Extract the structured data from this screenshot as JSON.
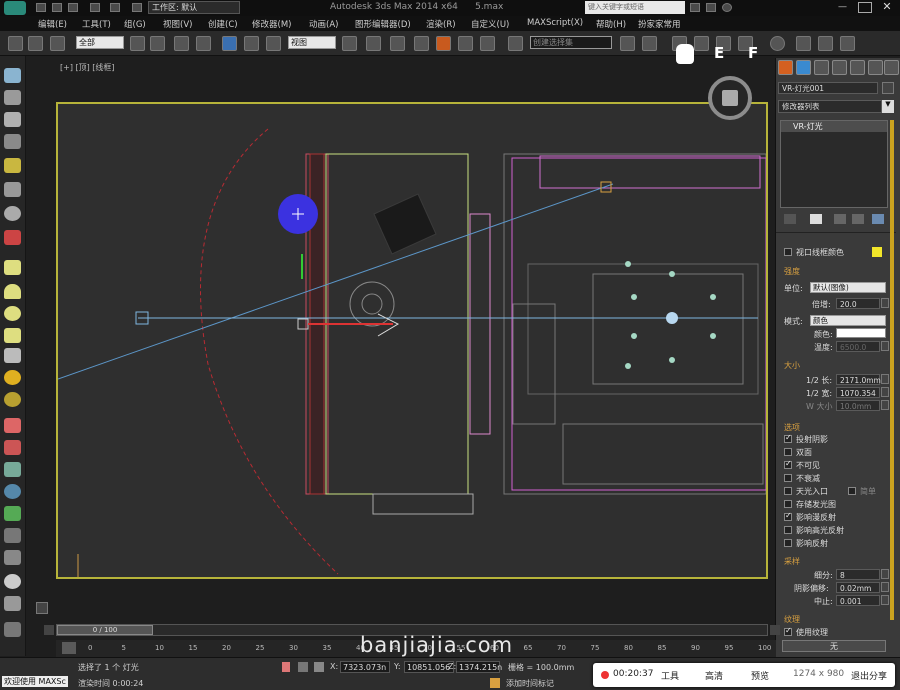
{
  "titlebar": {
    "workspace_label": "工作区: 默认",
    "app_title": "Autodesk 3ds Max  2014 x64",
    "file_name": "5.max",
    "search_placeholder": "键入关键字或短语"
  },
  "menus": [
    "编辑(E)",
    "工具(T)",
    "组(G)",
    "视图(V)",
    "创建(C)",
    "修改器(M)",
    "动画(A)",
    "图形编辑器(D)",
    "渲染(R)",
    "自定义(U)",
    "MAXScript(X)",
    "帮助(H)",
    "扮家家常用"
  ],
  "toolbar": {
    "selection_filter": "全部",
    "reference_coord": "视图",
    "selection_set": "创建选择集"
  },
  "viewport": {
    "label": "[+] [顶] [线框]",
    "hud_letters": [
      "E",
      "F"
    ]
  },
  "panel": {
    "object_name": "VR-灯光001",
    "modifier_list": "修改器列表",
    "stack_item": "VR-灯光",
    "viewport_wire_color": "视口线框颜色",
    "intensity_title": "强度",
    "unit_label": "单位:",
    "unit_value": "默认(图像)",
    "multiplier_label": "倍增:",
    "multiplier_value": "20.0",
    "mode_label": "模式:",
    "mode_value": "颜色",
    "color_label": "颜色:",
    "temp_label": "温度:",
    "temp_value": "6500.0",
    "size_title": "大小",
    "half_length_label": "1/2 长:",
    "half_length_value": "2171.0mm",
    "half_width_label": "1/2 宽:",
    "half_width_value": "1070.354",
    "w_size_label": "W 大小",
    "w_size_value": "10.0mm",
    "options_title": "选项",
    "options": [
      {
        "label": "投射阴影",
        "checked": true
      },
      {
        "label": "双面",
        "checked": false
      },
      {
        "label": "不可见",
        "checked": true
      },
      {
        "label": "不衰减",
        "checked": false
      },
      {
        "label": "天光入口",
        "checked": false
      },
      {
        "label": "存储发光图",
        "checked": false
      },
      {
        "label": "影响漫反射",
        "checked": true
      },
      {
        "label": "影响高光反射",
        "checked": false
      },
      {
        "label": "影响反射",
        "checked": false
      }
    ],
    "simple_label": "简单",
    "sampling_title": "采样",
    "subdivs_label": "细分:",
    "subdivs_value": "8",
    "shadow_bias_label": "阴影偏移:",
    "shadow_bias_value": "0.02mm",
    "cutoff_label": "中止:",
    "cutoff_value": "0.001",
    "texture_title": "纹理",
    "use_texture_label": "使用纹理",
    "none_button": "无"
  },
  "timeline": {
    "frame": "0 / 100"
  },
  "ruler_ticks": [
    "0",
    "5",
    "10",
    "15",
    "20",
    "25",
    "30",
    "35",
    "40",
    "45",
    "50",
    "55",
    "60",
    "65",
    "70",
    "75",
    "80",
    "85",
    "90",
    "95",
    "100"
  ],
  "status": {
    "welcome": "欢迎使用  MAXSc",
    "selected": "选择了 1 个 灯光",
    "render_time": "渲染时间  0:00:24",
    "x_label": "X:",
    "x_value": "7323.073n",
    "y_label": "Y:",
    "y_value": "10851.056",
    "z_label": "Z:",
    "z_value": "1374.215n",
    "grid": "栅格 = 100.0mm",
    "add_tag": "添加时间标记"
  },
  "recorder": {
    "time": "00:20:37",
    "tools": "工具",
    "quality": "高清",
    "preview": "预览",
    "resolution": "1274 x 980",
    "exit_share": "退出分享"
  },
  "watermark": "banjiajia.com",
  "colors": {
    "accent_yellow": "#b7b43a",
    "panel_orange": "#d8a040",
    "light_blue": "#3b32e0"
  }
}
